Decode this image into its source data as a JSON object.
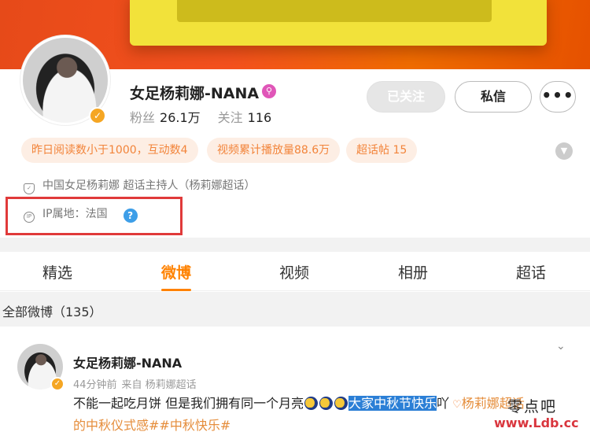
{
  "profile": {
    "name": "女足杨莉娜-NANA",
    "fans_label": "粉丝",
    "fans_value": "26.1万",
    "following_label": "关注",
    "following_value": "116",
    "verified_mark": "✓",
    "member_mark": "⚲"
  },
  "actions": {
    "followed_label": "已关注",
    "message_label": "私信",
    "more_label": "•••"
  },
  "tags": [
    "昨日阅读数小于1000，互动数4",
    "视频累计播放量88.6万",
    "超话帖 15"
  ],
  "info": {
    "title_line": "中国女足杨莉娜 超话主持人（杨莉娜超话）",
    "ip_line": "IP属地：法国",
    "ip_icon_text": "IP",
    "help_mark": "?"
  },
  "tabs": [
    "精选",
    "微博",
    "视频",
    "相册",
    "超话"
  ],
  "active_tab": "微博",
  "all_weibo_label": "全部微博（135）",
  "post": {
    "author": "女足杨莉娜-NANA",
    "time": "44分钟前",
    "source": "来自 杨莉娜超话",
    "text_part1": "不能一起吃月饼 但是我们拥有同一个月亮",
    "text_selected": "大家中秋节快乐",
    "text_part2": "吖",
    "super_topic": "杨莉娜超话",
    "topic_line2": "的中秋仪式感##中秋快乐#"
  },
  "watermark": {
    "line1": "零点吧",
    "line2": "www.Ldb.cc"
  },
  "colors": {
    "accent": "#ff8200",
    "tag_bg": "#fdeee4",
    "tag_text": "#f2843a",
    "highlight_box": "#e03a3a",
    "selection": "#2b7fd6"
  }
}
